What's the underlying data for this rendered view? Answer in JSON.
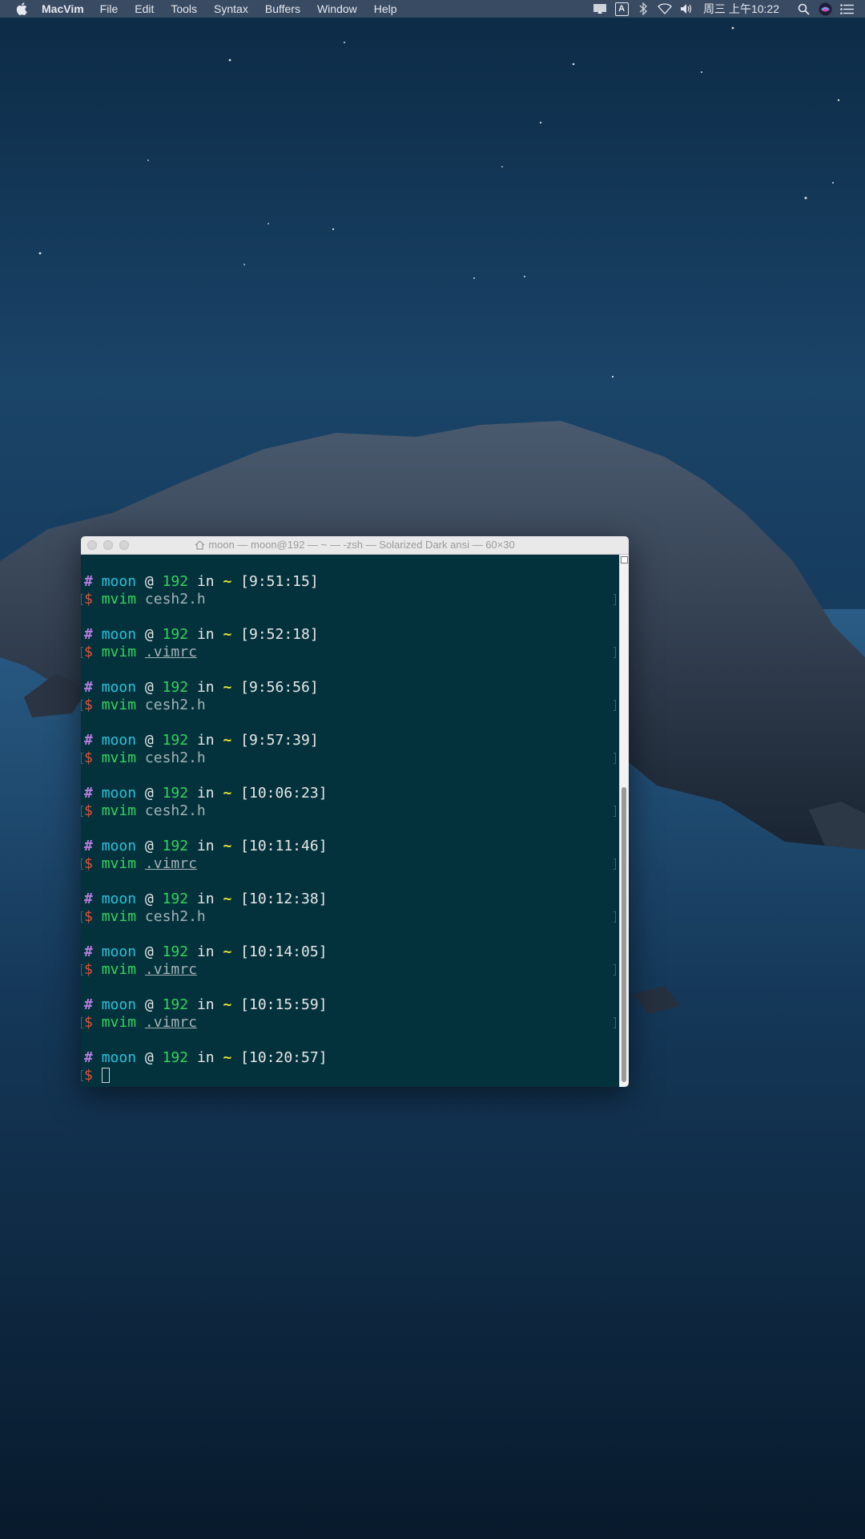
{
  "menubar": {
    "app_name": "MacVim",
    "items": [
      "File",
      "Edit",
      "Tools",
      "Syntax",
      "Buffers",
      "Window",
      "Help"
    ],
    "clock": "周三 上午10:22",
    "input_source_label": "A",
    "status_icons": [
      "display-mirroring-icon",
      "input-source-icon",
      "bluetooth-icon",
      "wifi-icon",
      "volume-icon",
      "spotlight-search-icon",
      "siri-icon",
      "notification-center-icon"
    ]
  },
  "terminal": {
    "title": "moon — moon@192 — ~ — -zsh — Solarized Dark ansi — 60×30",
    "title_icon": "home-icon",
    "colors": {
      "background": "#03323d",
      "user": "#2bc2da",
      "host": "#34d35c",
      "dir": "#e5e32a",
      "dollar": "#e4523c",
      "hash": "#b77cde"
    },
    "prompt": {
      "hash": "#",
      "user": "moon",
      "at": "@",
      "host": "192",
      "in": "in",
      "dir": "~",
      "dollar": "$"
    },
    "entries": [
      {
        "time": "[9:51:15]",
        "command": "mvim",
        "arg": "cesh2.h",
        "arg_underlined": false
      },
      {
        "time": "[9:52:18]",
        "command": "mvim",
        "arg": ".vimrc",
        "arg_underlined": true
      },
      {
        "time": "[9:56:56]",
        "command": "mvim",
        "arg": "cesh2.h",
        "arg_underlined": false
      },
      {
        "time": "[9:57:39]",
        "command": "mvim",
        "arg": "cesh2.h",
        "arg_underlined": false
      },
      {
        "time": "[10:06:23]",
        "command": "mvim",
        "arg": "cesh2.h",
        "arg_underlined": false
      },
      {
        "time": "[10:11:46]",
        "command": "mvim",
        "arg": ".vimrc",
        "arg_underlined": true
      },
      {
        "time": "[10:12:38]",
        "command": "mvim",
        "arg": "cesh2.h",
        "arg_underlined": false
      },
      {
        "time": "[10:14:05]",
        "command": "mvim",
        "arg": ".vimrc",
        "arg_underlined": true
      },
      {
        "time": "[10:15:59]",
        "command": "mvim",
        "arg": ".vimrc",
        "arg_underlined": true
      },
      {
        "time": "[10:20:57]",
        "command": "",
        "arg": "",
        "arg_underlined": false,
        "active": true
      }
    ]
  }
}
